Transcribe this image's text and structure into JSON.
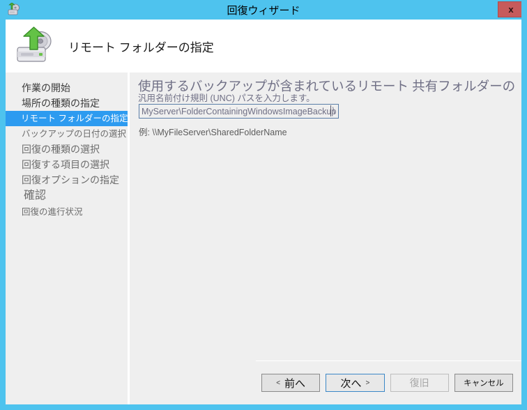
{
  "window": {
    "title": "回復ウィザード",
    "close_label": "x",
    "icon": "restore-disk-icon",
    "accent_color": "#4ec3ee"
  },
  "banner": {
    "icon": "restore-disk-icon",
    "title": "リモート フォルダーの指定"
  },
  "sidebar": {
    "items": [
      {
        "label": "作業の開始",
        "state": "done"
      },
      {
        "label": "場所の種類の指定",
        "state": "done"
      },
      {
        "label": "リモート フォルダーの指定",
        "state": "current"
      },
      {
        "label": "バックアップの日付の選択",
        "state": "pending"
      },
      {
        "label": "回復の種類の選択",
        "state": "pending"
      },
      {
        "label": "回復する項目の選択",
        "state": "pending"
      },
      {
        "label": "回復オプションの指定",
        "state": "pending"
      },
      {
        "label": "確認",
        "state": "pending"
      },
      {
        "label": "回復の進行状況",
        "state": "pending"
      }
    ],
    "highlight_color": "#2d9bf0"
  },
  "content": {
    "prompt_line_big": "使用するバックアップが含まれているリモート 共有フォルダーの",
    "prompt_line_small": "汎用名前付け規則 (UNC) パスを入力します。",
    "path_value": "MyServer\\FolderContainingWindowsImageBackup",
    "path_overflow": "\\",
    "path_placeholder": "\\\\MyFileServer\\SharedFolderName",
    "example_text": "例: \\\\MyFileServer\\SharedFolderName"
  },
  "footer": {
    "buttons": [
      {
        "label": "前へ",
        "chevron": "<",
        "state": "enabled",
        "name": "back-button"
      },
      {
        "label": "次へ",
        "chevron": ">",
        "state": "default",
        "name": "next-button"
      },
      {
        "label": "復旧",
        "chevron": "",
        "state": "disabled",
        "name": "recover-button"
      },
      {
        "label": "キャンセル",
        "chevron": "",
        "state": "enabled",
        "name": "cancel-button"
      }
    ]
  }
}
